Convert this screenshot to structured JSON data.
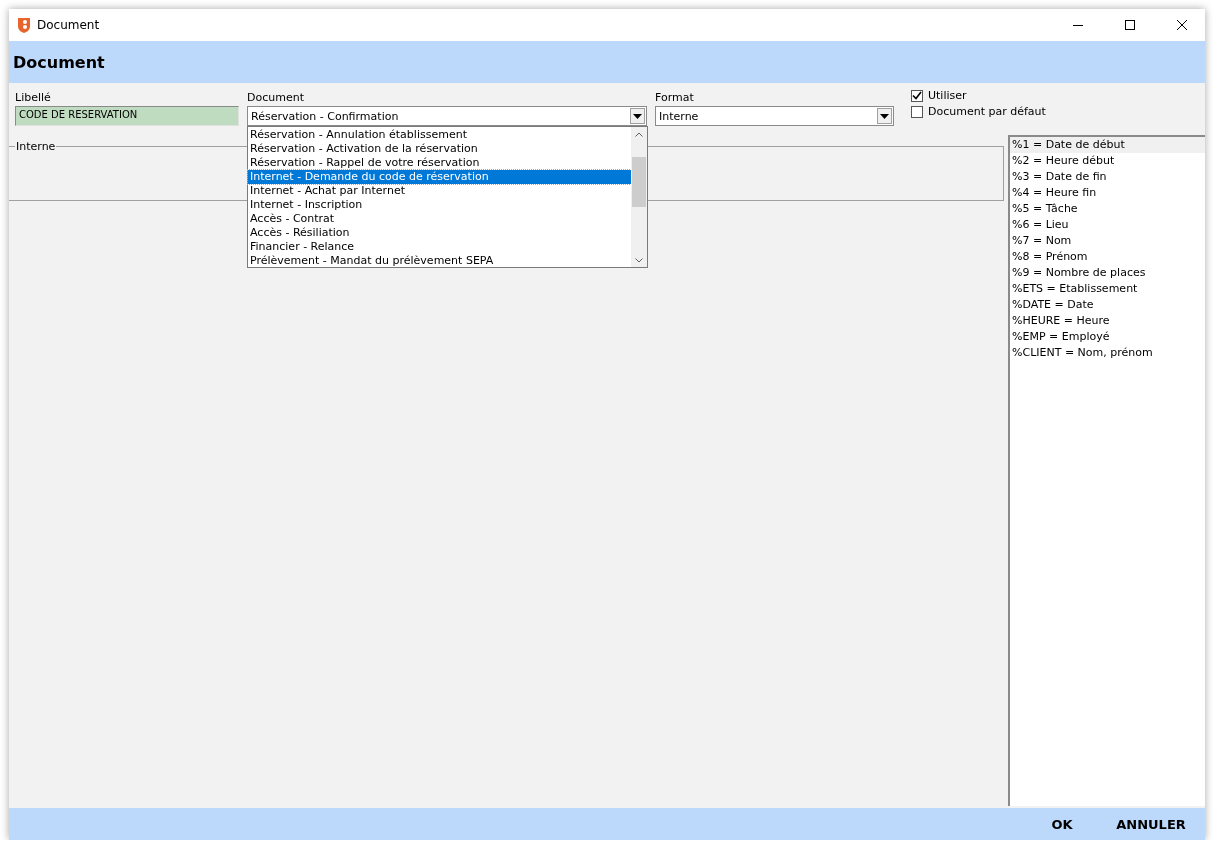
{
  "window": {
    "title": "Document"
  },
  "header": {
    "title": "Document"
  },
  "libelle": {
    "label": "Libellé",
    "value": "CODE DE RESERVATION"
  },
  "document": {
    "label": "Document",
    "value": "Réservation - Confirmation",
    "expanded": true,
    "options": [
      {
        "label": "Réservation - Annulation établissement",
        "selected": false
      },
      {
        "label": "Réservation - Activation de la réservation",
        "selected": false
      },
      {
        "label": "Réservation - Rappel de votre réservation",
        "selected": false
      },
      {
        "label": "Internet - Demande du code de réservation",
        "selected": true
      },
      {
        "label": "Internet - Achat par Internet",
        "selected": false
      },
      {
        "label": "Internet - Inscription",
        "selected": false
      },
      {
        "label": "Accès - Contrat",
        "selected": false
      },
      {
        "label": "Accès - Résiliation",
        "selected": false
      },
      {
        "label": "Financier - Relance",
        "selected": false
      },
      {
        "label": "Prélèvement - Mandat du prélèvement SEPA",
        "selected": false
      }
    ]
  },
  "format": {
    "label": "Format",
    "value": "Interne"
  },
  "checkboxes": [
    {
      "label": "Utiliser",
      "checked": true
    },
    {
      "label": "Document par défaut",
      "checked": false
    }
  ],
  "group": {
    "title": "Interne"
  },
  "variables": [
    {
      "label": "%1 = Date de début",
      "selected": true
    },
    {
      "label": "%2 = Heure début",
      "selected": false
    },
    {
      "label": "%3 = Date de fin",
      "selected": false
    },
    {
      "label": "%4 = Heure fin",
      "selected": false
    },
    {
      "label": "%5 = Tâche",
      "selected": false
    },
    {
      "label": "%6 = Lieu",
      "selected": false
    },
    {
      "label": "%7 = Nom",
      "selected": false
    },
    {
      "label": "%8 = Prénom",
      "selected": false
    },
    {
      "label": "%9 = Nombre de places",
      "selected": false
    },
    {
      "label": "%ETS = Etablissement",
      "selected": false
    },
    {
      "label": "%DATE = Date",
      "selected": false
    },
    {
      "label": "%HEURE = Heure",
      "selected": false
    },
    {
      "label": "%EMP = Employé",
      "selected": false
    },
    {
      "label": "%CLIENT = Nom, prénom",
      "selected": false
    }
  ],
  "buttons": [
    "OK",
    "ANNULER"
  ]
}
